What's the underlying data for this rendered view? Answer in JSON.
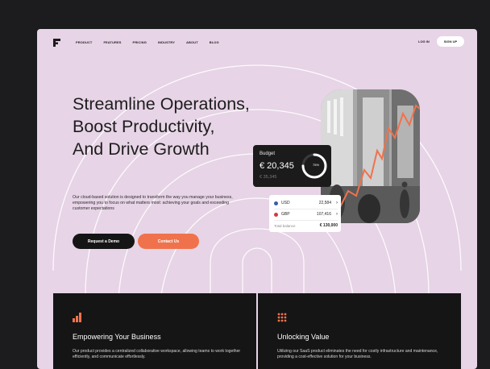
{
  "nav": {
    "items": [
      "PRODUCT",
      "FEATURES",
      "PRICING",
      "INDUSTRY",
      "ABOUT",
      "BLOG"
    ],
    "login": "LOG IN",
    "signup": "SIGN UP"
  },
  "hero": {
    "title_lines": [
      "Streamline Operations,",
      "Boost Productivity,",
      "And Drive Growth"
    ],
    "description": "Our cloud-based solution is designed to transform the way you manage your business, empowering you to focus on what matters most: achieving your goals and exceeding customer expectations",
    "demo_button": "Request a Demo",
    "contact_button": "Contact Us"
  },
  "budget": {
    "label": "Budget",
    "amount": "€ 20,345",
    "secondary": "€ 35,345",
    "percent": "75%",
    "progress": 0.75
  },
  "currency": {
    "rows": [
      {
        "code": "USD",
        "value": "22,584",
        "flag_color": "#3b5bab"
      },
      {
        "code": "GBP",
        "value": "107,416",
        "flag_color": "#d23b3b"
      }
    ],
    "total_label": "Total balance",
    "total_value": "€ 130,000"
  },
  "cards": [
    {
      "icon": "bar-chart-icon",
      "title": "Empowering Your Business",
      "description": "Our product provides a centralized collaborative workspace, allowing teams to work together efficiently, and communicate effortlessly."
    },
    {
      "icon": "grid-dots-icon",
      "title": "Unlocking Value",
      "description": "Utilizing our SaaS product eliminates the need for costly infrastructure and maintenance, providing a cost-effective solution for your business."
    }
  ],
  "colors": {
    "background": "#e7d4e6",
    "accent": "#f0724c",
    "dark": "#151515"
  }
}
